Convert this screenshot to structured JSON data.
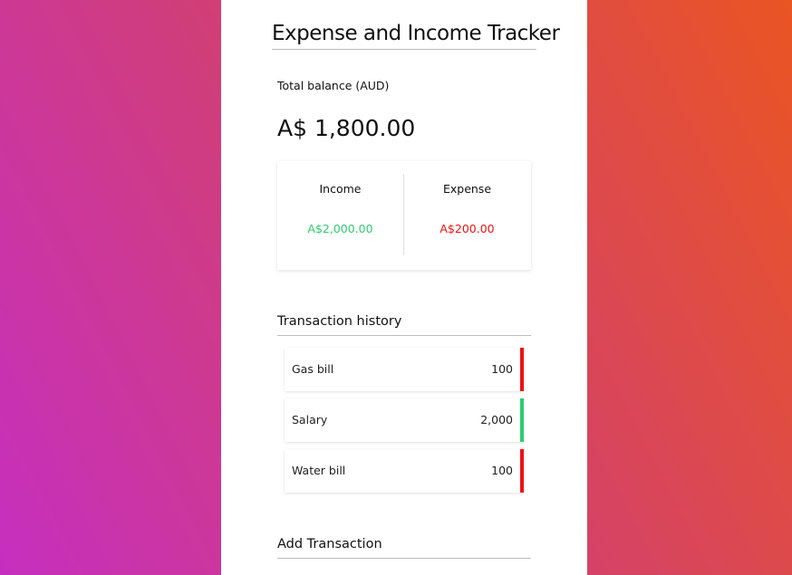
{
  "app": {
    "title": "Expense and Income Tracker"
  },
  "balance": {
    "label": "Total balance (AUD)",
    "value": "A$ 1,800.00"
  },
  "summary": {
    "income_label": "Income",
    "income_value": "A$2,000.00",
    "expense_label": "Expense",
    "expense_value": "A$200.00"
  },
  "history": {
    "title": "Transaction history",
    "items": [
      {
        "name": "Gas bill",
        "amount": "100",
        "type": "expense",
        "color": "#ee1111"
      },
      {
        "name": "Salary",
        "amount": "2,000",
        "type": "income",
        "color": "#2ecc71"
      },
      {
        "name": "Water bill",
        "amount": "100",
        "type": "expense",
        "color": "#ee1111"
      }
    ]
  },
  "add_transaction": {
    "title": "Add Transaction"
  },
  "colors": {
    "income": "#2ecc71",
    "expense": "#ee1111",
    "gradient_start": "#c62fbf",
    "gradient_end": "#ea5523"
  }
}
